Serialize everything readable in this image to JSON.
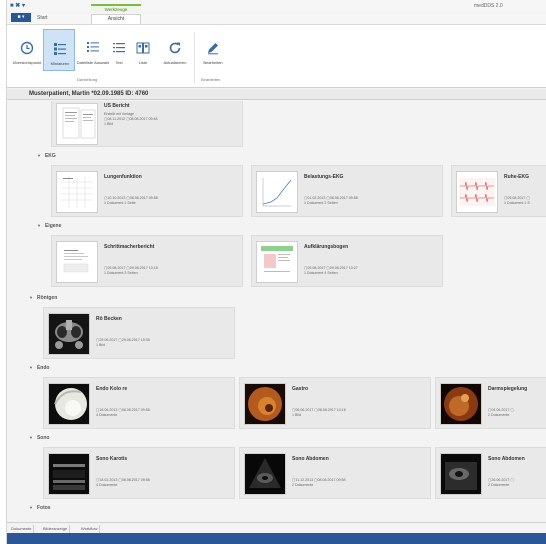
{
  "window": {
    "title": "medDDS 2.0",
    "quick_access": "■ ✖ ▾"
  },
  "ribbon": {
    "context_group": "Werkzeuge",
    "tabs": {
      "file": "■ ▾",
      "start": "Start",
      "active": "Ansicht"
    },
    "buttons": {
      "overview": "Übersichtspunkt",
      "thumbnails": "Miniaturen",
      "details": "Dateiliste Auswahl",
      "list": "Text",
      "tiles": "Liste",
      "refresh": "Aktualisieren",
      "edit": "Bearbeiten"
    },
    "groups": {
      "view": "Darstellung",
      "actions": "Bearbeiten"
    }
  },
  "patient": {
    "label": "Musterpatient, Martin   *02.09.1985   ID: 4760"
  },
  "sections": {
    "ekg": "EKG",
    "eigene": "Eigene",
    "roentgen": "Röntgen",
    "endo": "Endo",
    "sono": "Sono",
    "fotos": "Fotos"
  },
  "cards": {
    "top": {
      "title": "US Bericht",
      "meta1": "Erstellt mit Vorlage",
      "meta2": "▢08.11.2012  ▢08.08.2017 09:48",
      "meta3": "1 Bild"
    },
    "lungen": {
      "title": "Lungenfunktion",
      "meta1": "▢10.10.2013  ▢08.08.2017 09:58",
      "meta2": "1 Dokument  1 Seite"
    },
    "belast": {
      "title": "Belastungs-EKG",
      "meta1": "▢01.02.2013  ▢08.08.2017 09:58",
      "meta2": "1 Dokument  2 Seiten"
    },
    "ruhe": {
      "title": "Ruhe-EKG",
      "meta1": "▢09.08.2017  ▢",
      "meta2": "1 Dokument  1 S"
    },
    "schritt": {
      "title": "Schrittmacherbericht",
      "meta1": "▢09.08.2017  ▢09.08.2017 10:18",
      "meta2": "1 Dokument  3 Seiten"
    },
    "aufkl": {
      "title": "Aufklärungsbogen",
      "meta1": "▢09.08.2017  ▢09.08.2017 10:27",
      "meta2": "1 Dokument  4 Seiten"
    },
    "becken": {
      "title": "Rö Becken",
      "meta1": "▢29.06.2017  ▢29.06.2017 15:35",
      "meta2": "1 Bild"
    },
    "koloskopie": {
      "title": "Endo Kolo re",
      "meta1": "▢16.06.2013  ▢08.08.2017 09:58",
      "meta2": "4 Dokumente"
    },
    "gastro": {
      "title": "Gastro",
      "meta1": "▢06.06.2017  ▢08.08.2017 10:16",
      "meta2": "1 Bild"
    },
    "darmsp": {
      "title": "Darmspiegelung",
      "meta1": "▢04.06.2017  ▢",
      "meta2": "2 Dokumente"
    },
    "sono_karotis": {
      "title": "Sono Karotis",
      "meta1": "▢18.02.2013  ▢08.08.2017 09:58",
      "meta2": "4 Dokumente"
    },
    "sono_abdomen1": {
      "title": "Sono Abdomen",
      "meta1": "▢11.12.2013  ▢08.08.2017 09:58",
      "meta2": "2 Dokumente"
    },
    "sono_abdomen2": {
      "title": "Sono Abdomen",
      "meta1": "▢26.06.2017  ▢",
      "meta2": "2 Dokumente"
    }
  },
  "bottom_tabs": {
    "t1": "Dokumente",
    "t2": "Bilderanzeige",
    "t3": "Workflow"
  },
  "colors": {
    "accent": "#2b5797",
    "context_green": "#7dbb44",
    "selected": "#cfe3f7"
  }
}
